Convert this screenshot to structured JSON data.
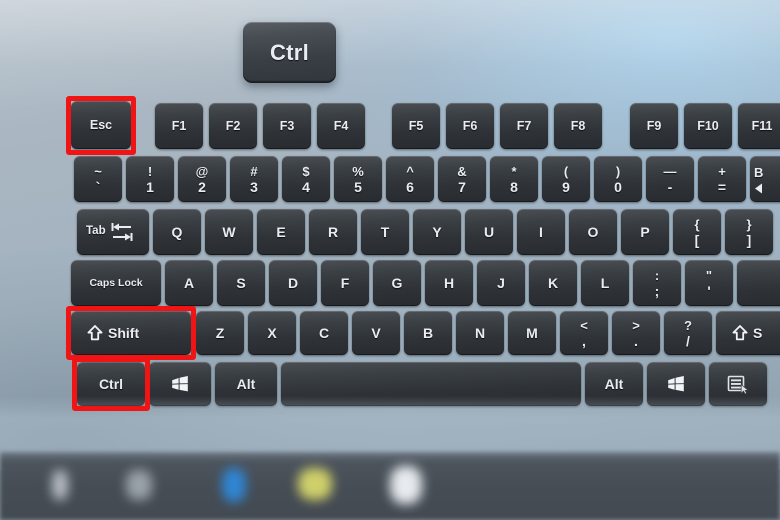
{
  "scene": {
    "description": "Close-up photo of a laptop keyboard with Esc, left Shift and left Ctrl keys outlined in red, and an enlarged Ctrl key floating above",
    "background_colors": {
      "deck_light": "#b9c4cd",
      "deck_dark": "#8d9dab",
      "highlight_red": "#f01414",
      "key_face": "#33373c",
      "key_text": "#e9edf1",
      "taskbar": "#464d55"
    }
  },
  "callout": {
    "key_label": "Ctrl",
    "name": "floating-ctrl-key"
  },
  "highlights": [
    {
      "target": "Esc",
      "color": "#f01414"
    },
    {
      "target": "Shift",
      "color": "#f01414"
    },
    {
      "target": "Ctrl",
      "color": "#f01414"
    }
  ],
  "keyboard": {
    "rows": {
      "function_row": [
        {
          "label": "Esc"
        },
        {
          "label": "F1"
        },
        {
          "label": "F2"
        },
        {
          "label": "F3"
        },
        {
          "label": "F4"
        },
        {
          "label": "F5"
        },
        {
          "label": "F6"
        },
        {
          "label": "F7"
        },
        {
          "label": "F8"
        },
        {
          "label": "F9"
        },
        {
          "label": "F10"
        },
        {
          "label": "F11"
        }
      ],
      "number_row": [
        {
          "top": "~",
          "bottom": "`"
        },
        {
          "top": "!",
          "bottom": "1"
        },
        {
          "top": "@",
          "bottom": "2"
        },
        {
          "top": "#",
          "bottom": "3"
        },
        {
          "top": "$",
          "bottom": "4"
        },
        {
          "top": "%",
          "bottom": "5"
        },
        {
          "top": "^",
          "bottom": "6"
        },
        {
          "top": "&",
          "bottom": "7"
        },
        {
          "top": "*",
          "bottom": "8"
        },
        {
          "top": "(",
          "bottom": "9"
        },
        {
          "top": ")",
          "bottom": "0"
        },
        {
          "top": "—",
          "bottom": "-"
        },
        {
          "top": "+",
          "bottom": "="
        },
        {
          "top": "B",
          "bottom": "",
          "note": "backspace-cut-off"
        }
      ],
      "top_letter_row": [
        {
          "label": "Tab",
          "icon": "tab-arrows-icon"
        },
        {
          "label": "Q"
        },
        {
          "label": "W"
        },
        {
          "label": "E"
        },
        {
          "label": "R"
        },
        {
          "label": "T"
        },
        {
          "label": "Y"
        },
        {
          "label": "U"
        },
        {
          "label": "I"
        },
        {
          "label": "O"
        },
        {
          "label": "P"
        },
        {
          "top": "{",
          "bottom": "["
        },
        {
          "top": "}",
          "bottom": "]"
        }
      ],
      "home_row": [
        {
          "label": "Caps Lock"
        },
        {
          "label": "A"
        },
        {
          "label": "S"
        },
        {
          "label": "D"
        },
        {
          "label": "F"
        },
        {
          "label": "G"
        },
        {
          "label": "H"
        },
        {
          "label": "J"
        },
        {
          "label": "K"
        },
        {
          "label": "L"
        },
        {
          "top": ":",
          "bottom": ";"
        },
        {
          "top": "\"",
          "bottom": "'"
        },
        {
          "label": "",
          "note": "enter-cut-off"
        }
      ],
      "bottom_letter_row": [
        {
          "label": "Shift",
          "icon": "shift-arrow-icon"
        },
        {
          "label": "Z"
        },
        {
          "label": "X"
        },
        {
          "label": "C"
        },
        {
          "label": "V"
        },
        {
          "label": "B"
        },
        {
          "label": "N"
        },
        {
          "label": "M"
        },
        {
          "top": "<",
          "bottom": ","
        },
        {
          "top": ">",
          "bottom": "."
        },
        {
          "top": "?",
          "bottom": "/"
        },
        {
          "label": "S",
          "icon": "shift-arrow-icon",
          "note": "right-shift-cut-off"
        }
      ],
      "modifier_row": [
        {
          "label": "Ctrl"
        },
        {
          "label": "",
          "icon": "windows-logo-icon"
        },
        {
          "label": "Alt"
        },
        {
          "label": "",
          "note": "spacebar"
        },
        {
          "label": "Alt"
        },
        {
          "label": "",
          "icon": "windows-logo-icon"
        },
        {
          "label": "",
          "icon": "context-menu-icon"
        }
      ]
    }
  },
  "taskbar": {
    "icons": [
      {
        "name": "taskbar-icon-1",
        "color": "#b9bec4"
      },
      {
        "name": "taskbar-icon-2",
        "color": "#9aa2aa"
      },
      {
        "name": "taskbar-icon-3",
        "color": "#2f86d4"
      },
      {
        "name": "taskbar-icon-4",
        "color": "#cfd06a"
      },
      {
        "name": "taskbar-icon-5",
        "color": "#e7ebef"
      }
    ]
  }
}
